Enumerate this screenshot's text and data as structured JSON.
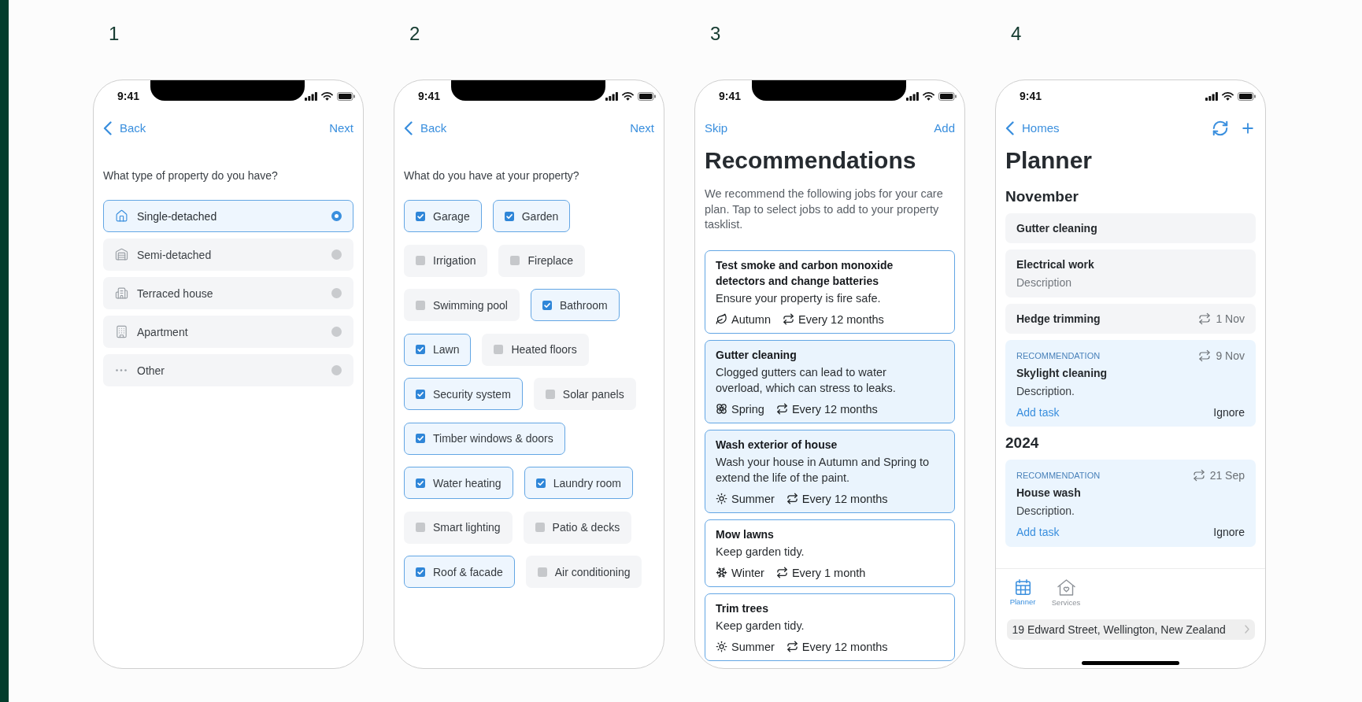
{
  "steps": [
    {
      "number": "1",
      "kind": "choice",
      "notch": true,
      "status_time": "9:41",
      "nav": {
        "left": {
          "kind": "back",
          "label": "Back"
        },
        "right": {
          "kind": "text",
          "label": "Next"
        }
      },
      "question": "What type of property do you have?",
      "options": [
        {
          "label": "Single-detached",
          "selected": true
        },
        {
          "label": "Semi-detached",
          "selected": false
        },
        {
          "label": "Terraced house",
          "selected": false
        },
        {
          "label": "Apartment",
          "selected": false
        },
        {
          "label": "Other",
          "selected": false
        }
      ]
    },
    {
      "number": "2",
      "kind": "checklist",
      "notch": true,
      "status_time": "9:41",
      "nav": {
        "left": {
          "kind": "back",
          "label": "Back"
        },
        "right": {
          "kind": "text",
          "label": "Next"
        }
      },
      "question": "What do you have at your property?",
      "items": [
        {
          "label": "Garage",
          "checked": true
        },
        {
          "label": "Garden",
          "checked": true
        },
        {
          "label": "Irrigation",
          "checked": false
        },
        {
          "label": "Fireplace",
          "checked": false
        },
        {
          "label": "Swimming pool",
          "checked": false
        },
        {
          "label": "Bathroom",
          "checked": true
        },
        {
          "label": "Lawn",
          "checked": true
        },
        {
          "label": "Heated floors",
          "checked": false
        },
        {
          "label": "Security system",
          "checked": true
        },
        {
          "label": "Solar panels",
          "checked": false
        },
        {
          "label": "Timber windows & doors",
          "checked": true
        },
        {
          "label": "Water heating",
          "checked": true
        },
        {
          "label": "Laundry room",
          "checked": true
        },
        {
          "label": "Smart lighting",
          "checked": false
        },
        {
          "label": "Patio & decks",
          "checked": false
        },
        {
          "label": "Roof & facade",
          "checked": true
        },
        {
          "label": "Air conditioning",
          "checked": false
        }
      ]
    },
    {
      "number": "3",
      "kind": "recommendations",
      "notch": true,
      "status_time": "9:41",
      "nav": {
        "left": {
          "kind": "text",
          "label": "Skip"
        },
        "right": {
          "kind": "text",
          "label": "Add"
        }
      },
      "title": "Recommendations",
      "intro": "We recommend the following jobs for your care plan. Tap to select jobs to add to your property tasklist.",
      "jobs": [
        {
          "title": "Test smoke and carbon monoxide detectors and change batteries",
          "description": "Ensure your property is fire safe.",
          "season": "Autumn",
          "frequency": "Every 12 months",
          "selected": false
        },
        {
          "title": "Gutter cleaning",
          "description": "Clogged gutters can lead to water overload, which can stress to leaks.",
          "season": "Spring",
          "frequency": "Every 12 months",
          "selected": true
        },
        {
          "title": "Wash exterior of house",
          "description": "Wash your house in Autumn and Spring to extend the life of the paint.",
          "season": "Summer",
          "frequency": "Every 12 months",
          "selected": true
        },
        {
          "title": "Mow lawns",
          "description": "Keep garden tidy.",
          "season": "Winter",
          "frequency": "Every 1 month",
          "selected": false
        },
        {
          "title": "Trim trees",
          "description": "Keep garden tidy.",
          "season": "Summer",
          "frequency": "Every 12 months",
          "selected": false
        }
      ]
    },
    {
      "number": "4",
      "kind": "planner",
      "status_time": "9:41",
      "nav": {
        "left": {
          "kind": "back",
          "label": "Homes"
        }
      },
      "title": "Planner",
      "sections": [
        {
          "heading": "November",
          "items": [
            {
              "kind": "task",
              "title": "Gutter cleaning"
            },
            {
              "kind": "task",
              "title": "Electrical work",
              "description": "Description"
            },
            {
              "kind": "task",
              "title": "Hedge trimming",
              "date": "1 Nov"
            },
            {
              "kind": "recommendation",
              "label": "RECOMMENDATION",
              "date": "9 Nov",
              "title": "Skylight cleaning",
              "description": "Description.",
              "add": "Add task",
              "ignore": "Ignore"
            }
          ]
        },
        {
          "heading": "2024",
          "items": [
            {
              "kind": "recommendation",
              "label": "RECOMMENDATION",
              "date": "21 Sep",
              "title": "House wash",
              "description": "Description.",
              "add": "Add task",
              "ignore": "Ignore"
            }
          ]
        }
      ],
      "tabs": [
        {
          "label": "Planner",
          "selected": true
        },
        {
          "label": "Services",
          "selected": false
        }
      ],
      "address": "19 Edward Street, Wellington, New Zealand"
    }
  ]
}
